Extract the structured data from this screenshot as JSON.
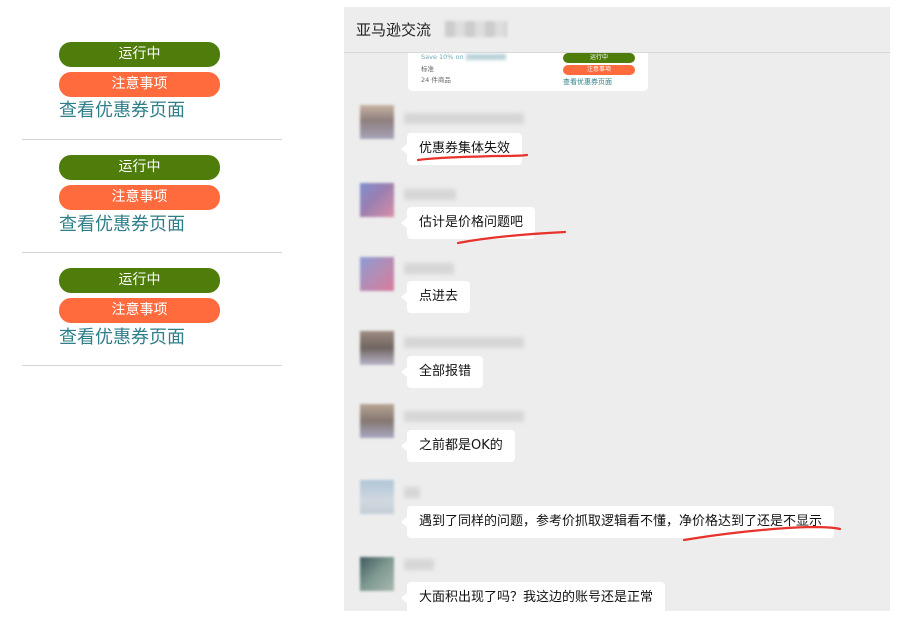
{
  "coupon_list": {
    "entries": [
      {
        "status": "运行中",
        "notice": "注意事项",
        "link": "查看优惠券页面"
      },
      {
        "status": "运行中",
        "notice": "注意事项",
        "link": "查看优惠券页面"
      },
      {
        "status": "运行中",
        "notice": "注意事项",
        "link": "查看优惠券页面"
      }
    ]
  },
  "chat": {
    "title": "亚马逊交流",
    "card": {
      "save_text": "Save 10% on",
      "standard": "标准",
      "count": "24 件商品",
      "status": "运行中",
      "notice": "注意事项",
      "link": "查看优惠券页面"
    },
    "messages": [
      {
        "avatar": "avatar-1",
        "text": "优惠券集体失效"
      },
      {
        "avatar": "avatar-2",
        "text": "估计是价格问题吧"
      },
      {
        "avatar": "avatar-3",
        "text": "点进去"
      },
      {
        "avatar": "avatar-4",
        "text": "全部报错"
      },
      {
        "avatar": "avatar-5",
        "text": "之前都是OK的"
      },
      {
        "avatar": "avatar-6",
        "text": "遇到了同样的问题，参考价抓取逻辑看不懂，净价格达到了还是不显示"
      },
      {
        "avatar": "avatar-7",
        "text": "大面积出现了吗？我这边的账号还是正常"
      }
    ]
  },
  "colors": {
    "status_green": "#4f7d0b",
    "notice_orange": "#ff6b3d",
    "link_teal": "#2f7f89",
    "annotation_red": "#e8332c",
    "chat_background": "#ededed"
  }
}
